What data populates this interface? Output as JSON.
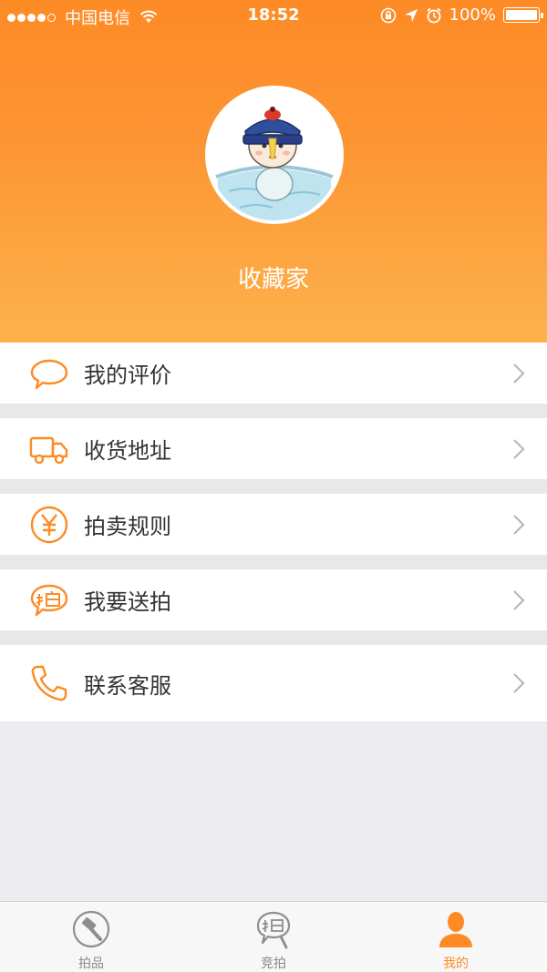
{
  "status_bar": {
    "carrier": "中国电信",
    "time": "18:52",
    "battery": "100%"
  },
  "profile": {
    "username": "收藏家"
  },
  "menu": {
    "items": [
      {
        "label": "我的评价",
        "icon": "chat-bubble-icon"
      },
      {
        "label": "收货地址",
        "icon": "truck-icon"
      },
      {
        "label": "拍卖规则",
        "icon": "yuan-icon"
      },
      {
        "label": "我要送拍",
        "icon": "pai-bubble-icon"
      },
      {
        "label": "联系客服",
        "icon": "phone-icon"
      }
    ]
  },
  "tabbar": {
    "tabs": [
      {
        "label": "拍品",
        "icon": "gavel-icon"
      },
      {
        "label": "竞拍",
        "icon": "bid-icon"
      },
      {
        "label": "我的",
        "icon": "user-icon"
      }
    ],
    "active_index": 2
  },
  "colors": {
    "accent": "#fd8b25",
    "background": "#ebebf0"
  }
}
